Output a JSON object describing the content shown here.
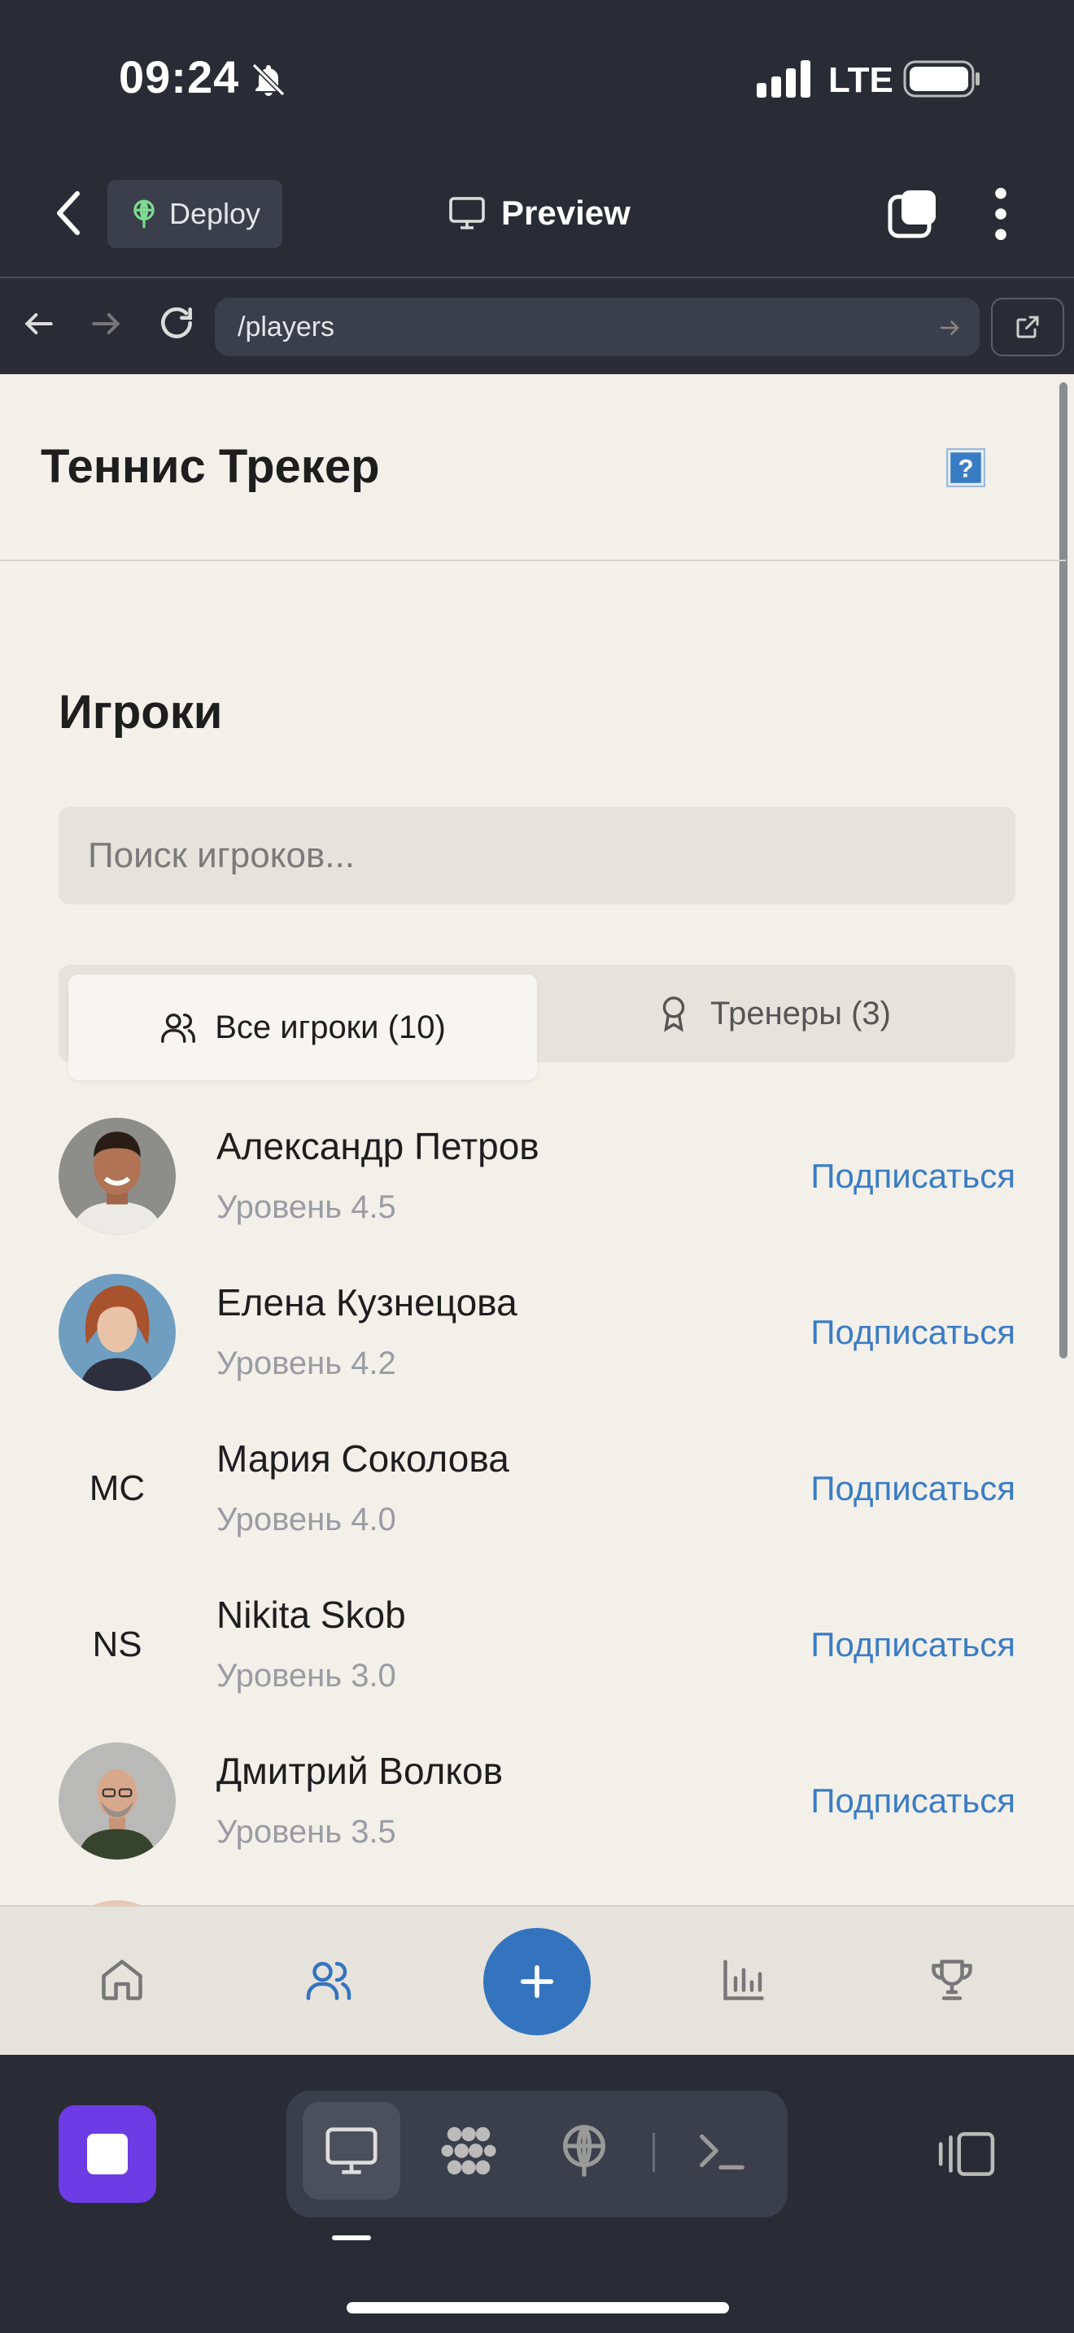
{
  "status_bar": {
    "time": "09:24",
    "network": "LTE"
  },
  "editor_toolbar": {
    "deploy_label": "Deploy",
    "preview_label": "Preview"
  },
  "url_bar": {
    "url": "/players"
  },
  "app": {
    "title": "Теннис Трекер",
    "section_title": "Игроки",
    "search": {
      "placeholder": "Поиск игроков...",
      "value": ""
    },
    "tabs": [
      {
        "label": "Все игроки (10)",
        "icon": "users-icon",
        "active": true
      },
      {
        "label": "Тренеры (3)",
        "icon": "award-icon",
        "active": false
      }
    ],
    "players": [
      {
        "name": "Александр Петров",
        "level": "Уровень 4.5",
        "action": "Подписаться",
        "avatar": "photo"
      },
      {
        "name": "Елена Кузнецова",
        "level": "Уровень 4.2",
        "action": "Подписаться",
        "avatar": "photo"
      },
      {
        "name": "Мария Соколова",
        "level": "Уровень 4.0",
        "action": "Подписаться",
        "initials": "МС"
      },
      {
        "name": "Nikita Skob",
        "level": "Уровень 3.0",
        "action": "Подписаться",
        "initials": "NS"
      },
      {
        "name": "Дмитрий Волков",
        "level": "Уровень 3.5",
        "action": "Подписаться",
        "avatar": "photo"
      }
    ],
    "bottom_nav": [
      "home-icon",
      "users-icon",
      "plus-icon",
      "bar-chart-icon",
      "trophy-icon"
    ]
  },
  "colors": {
    "accent": "#3474bf",
    "link": "#3a7cc4",
    "background": "#f3f0ea",
    "editor_bg": "#292c35",
    "stop": "#6d3be3"
  },
  "dock": {
    "modes": [
      "desktop-icon",
      "ai-agent-icon",
      "deploy-icon",
      "console-icon"
    ],
    "active_mode": "desktop-icon"
  }
}
